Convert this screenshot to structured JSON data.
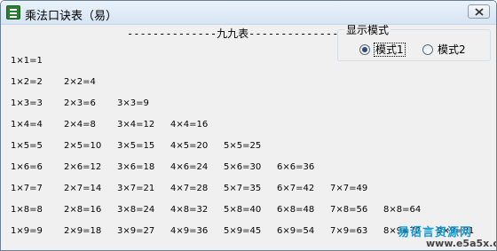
{
  "window": {
    "title": "乘法口诀表（易）",
    "close_icon": "close-icon"
  },
  "header": "--------------九九表--------------",
  "mode_group": {
    "title": "显示模式",
    "options": [
      {
        "label": "模式1",
        "checked": true
      },
      {
        "label": "模式2",
        "checked": false
      }
    ]
  },
  "table": {
    "rows": [
      [
        "1×1=1"
      ],
      [
        "1×2=2",
        "2×2=4"
      ],
      [
        "1×3=3",
        "2×3=6",
        "3×3=9"
      ],
      [
        "1×4=4",
        "2×4=8",
        "3×4=12",
        "4×4=16"
      ],
      [
        "1×5=5",
        "2×5=10",
        "3×5=15",
        "4×5=20",
        "5×5=25"
      ],
      [
        "1×6=6",
        "2×6=12",
        "3×6=18",
        "4×6=24",
        "5×6=30",
        "6×6=36"
      ],
      [
        "1×7=7",
        "2×7=14",
        "3×7=21",
        "4×7=28",
        "5×7=35",
        "6×7=42",
        "7×7=49"
      ],
      [
        "1×8=8",
        "2×8=16",
        "3×8=24",
        "4×8=32",
        "5×8=40",
        "6×8=48",
        "7×8=56",
        "8×8=64"
      ],
      [
        "1×9=9",
        "2×9=18",
        "3×9=27",
        "4×9=36",
        "5×9=45",
        "6×9=54",
        "7×9=63",
        "8×9=72",
        "9×9=81"
      ]
    ]
  },
  "watermark": {
    "cn": "易语言资源网",
    "en": "www.e5a5x.com"
  }
}
